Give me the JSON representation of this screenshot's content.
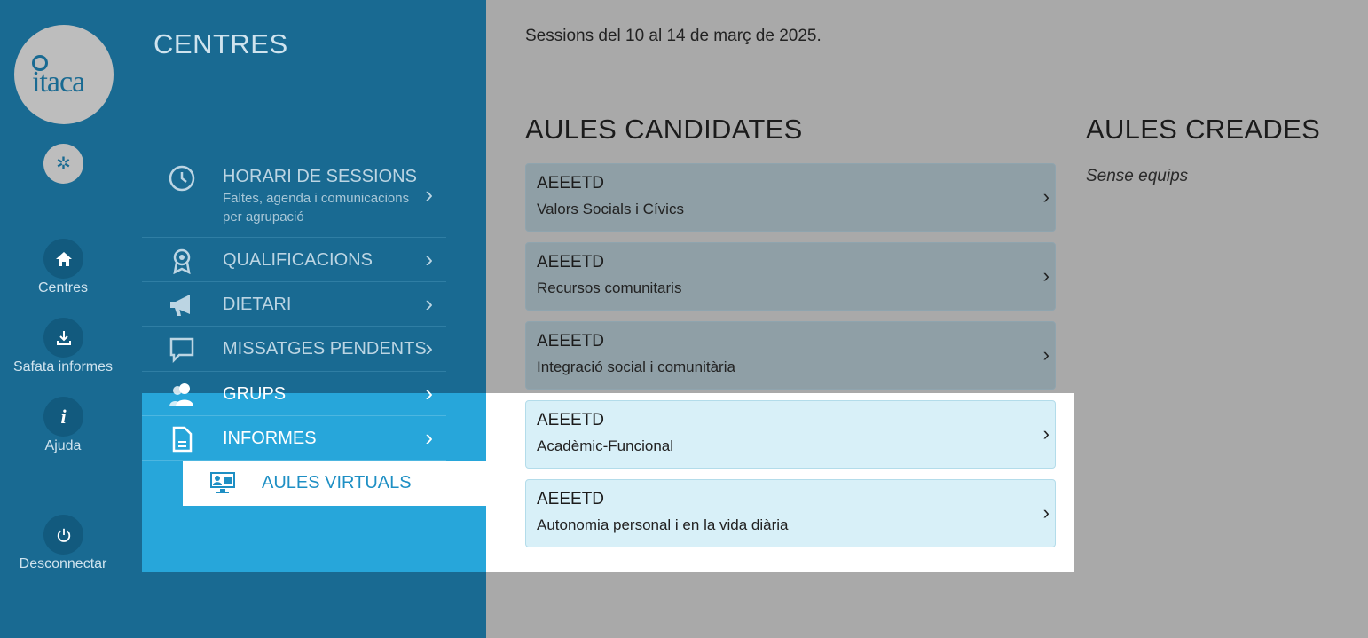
{
  "rail": {
    "logo_text": "itaca",
    "items": [
      {
        "label": "Centres",
        "icon": "home-icon"
      },
      {
        "label": "Safata informes",
        "icon": "download-icon"
      },
      {
        "label": "Ajuda",
        "icon": "info-icon"
      },
      {
        "label": "Desconnectar",
        "icon": "power-icon"
      }
    ]
  },
  "section_title": "CENTRES",
  "nav": [
    {
      "label": "HORARI DE SESSIONS",
      "sub": "Faltes, agenda i comunicacions per agrupació",
      "icon": "clock-icon"
    },
    {
      "label": "QUALIFICACIONS",
      "icon": "award-icon"
    },
    {
      "label": "DIETARI",
      "icon": "megaphone-icon"
    },
    {
      "label": "MISSATGES PENDENTS",
      "icon": "message-icon"
    },
    {
      "label": "GRUPS",
      "icon": "users-icon"
    },
    {
      "label": "INFORMES",
      "icon": "document-icon"
    }
  ],
  "sub_nav": {
    "label": "AULES VIRTUALS",
    "icon": "classroom-icon"
  },
  "main": {
    "sessions_text": "Sessions del 10 al 14 de març de 2025.",
    "candidates_title": "AULES CANDIDATES",
    "created_title": "AULES CREADES",
    "created_empty": "Sense equips",
    "cards": [
      {
        "code": "AEEETD",
        "name": "Valors Socials i Cívics"
      },
      {
        "code": "AEEETD",
        "name": "Recursos comunitaris"
      },
      {
        "code": "AEEETD",
        "name": "Integració social i comunitària"
      },
      {
        "code": "AEEETD",
        "name": "Acadèmic-Funcional"
      },
      {
        "code": "AEEETD",
        "name": "Autonomia personal i en la vida diària"
      }
    ]
  },
  "colors": {
    "rail": "#196a92",
    "active": "#27a6da",
    "overlay": "#a9a9a9",
    "card_highlight": "#d8f0f8"
  }
}
